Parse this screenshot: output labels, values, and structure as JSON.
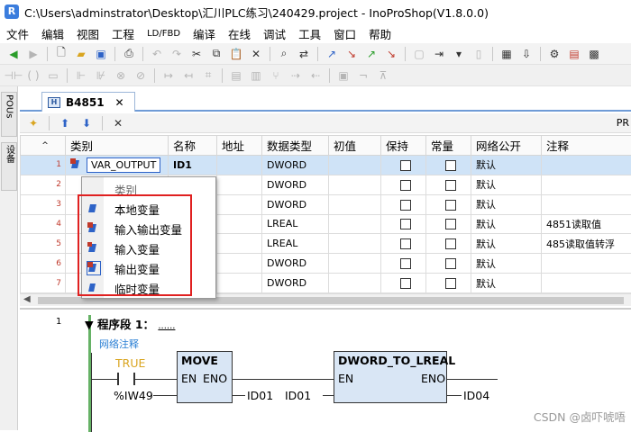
{
  "window": {
    "title": "C:\\Users\\adminstrator\\Desktop\\汇川PLC练习\\240429.project - InoProShop(V1.8.0.0)"
  },
  "menu": [
    "文件",
    "编辑",
    "视图",
    "工程",
    "LD/FBD",
    "编译",
    "在线",
    "调试",
    "工具",
    "窗口",
    "帮助"
  ],
  "left_strip": {
    "pous_tab": "POUs",
    "devices_tab": "设备"
  },
  "doc_tab": {
    "label": "B4851",
    "close": "✕"
  },
  "var_toolbar": {
    "right_label": "PR"
  },
  "table": {
    "headers": [
      "类别",
      "名称",
      "地址",
      "数据类型",
      "初值",
      "保持",
      "常量",
      "网络公开",
      "注释"
    ],
    "rows": [
      {
        "num": "1",
        "category": "VAR_OUTPUT",
        "name": "ID1",
        "type": "DWORD",
        "public": "默认",
        "comment": ""
      },
      {
        "num": "2",
        "category": "",
        "name": "",
        "type": "DWORD",
        "public": "默认",
        "comment": ""
      },
      {
        "num": "3",
        "category": "",
        "name": "",
        "type": "DWORD",
        "public": "默认",
        "comment": ""
      },
      {
        "num": "4",
        "category": "",
        "name": "",
        "type": "LREAL",
        "public": "默认",
        "comment": "4851读取值"
      },
      {
        "num": "5",
        "category": "",
        "name": "",
        "type": "LREAL",
        "public": "默认",
        "comment": "485读取值转浮"
      },
      {
        "num": "6",
        "category": "",
        "name": "",
        "type": "DWORD",
        "public": "默认",
        "comment": ""
      },
      {
        "num": "7",
        "category": "",
        "name": "",
        "type": "DWORD",
        "public": "默认",
        "comment": ""
      }
    ]
  },
  "dropdown": {
    "header": "类别",
    "items": [
      "本地变量",
      "输入输出变量",
      "输入变量",
      "输出变量",
      "临时变量"
    ]
  },
  "ladder": {
    "network_number": "1",
    "network_title": "▼ 程序段 1：",
    "network_title_suffix": "......",
    "comment": "网络注释",
    "contact_label": "TRUE",
    "input_var": "%IW49",
    "move_block": {
      "title": "MOVE",
      "en": "EN",
      "eno": "ENO"
    },
    "move_out": "ID01",
    "conv_in": "ID01",
    "conv_block": {
      "title": "DWORD_TO_LREAL",
      "en": "EN",
      "eno": "ENO"
    },
    "conv_out": "ID04"
  },
  "watermark": "CSDN @卤吓唬唔",
  "colors": {
    "accent": "#2e63c7",
    "row_selected": "#cfe3f7",
    "highlight_box": "#e02020",
    "network_bar": "#66b266"
  }
}
